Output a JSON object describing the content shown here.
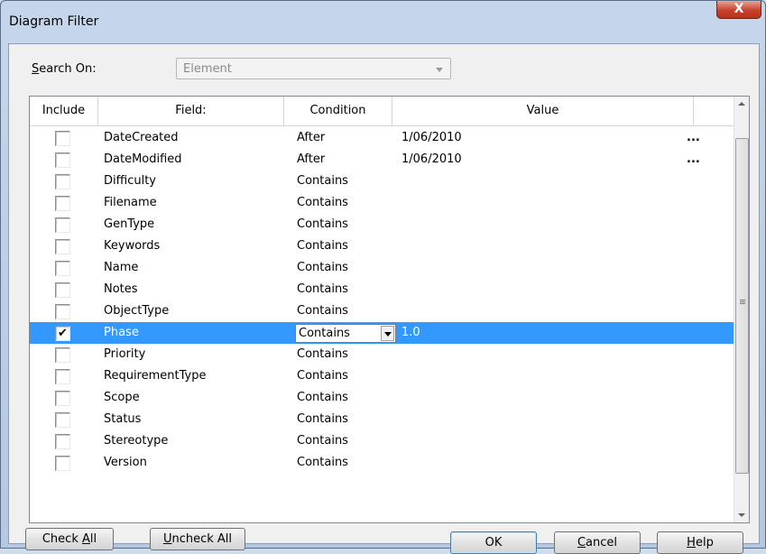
{
  "window": {
    "title": "Diagram Filter",
    "close_label": "X"
  },
  "search": {
    "label_pre": "",
    "label_accel": "S",
    "label_post": "earch On:",
    "value": "Element"
  },
  "grid": {
    "columns": {
      "include": "Include",
      "field": "Field:",
      "condition": "Condition",
      "value": "Value"
    },
    "rows": [
      {
        "field": "DateCreated",
        "condition": "After",
        "value": "1/06/2010",
        "ellipsis": "...",
        "checked": false
      },
      {
        "field": "DateModified",
        "condition": "After",
        "value": "1/06/2010",
        "ellipsis": "...",
        "checked": false
      },
      {
        "field": "Difficulty",
        "condition": "Contains",
        "value": "",
        "checked": false
      },
      {
        "field": "Filename",
        "condition": "Contains",
        "value": "",
        "checked": false
      },
      {
        "field": "GenType",
        "condition": "Contains",
        "value": "",
        "checked": false
      },
      {
        "field": "Keywords",
        "condition": "Contains",
        "value": "",
        "checked": false
      },
      {
        "field": "Name",
        "condition": "Contains",
        "value": "",
        "checked": false
      },
      {
        "field": "Notes",
        "condition": "Contains",
        "value": "",
        "checked": false
      },
      {
        "field": "ObjectType",
        "condition": "Contains",
        "value": "",
        "checked": false
      },
      {
        "field": "Phase",
        "condition": "Contains",
        "value": "1.0",
        "checked": true,
        "selected": true
      },
      {
        "field": "Priority",
        "condition": "Contains",
        "value": "",
        "checked": false
      },
      {
        "field": "RequirementType",
        "condition": "Contains",
        "value": "",
        "checked": false
      },
      {
        "field": "Scope",
        "condition": "Contains",
        "value": "",
        "checked": false
      },
      {
        "field": "Status",
        "condition": "Contains",
        "value": "",
        "checked": false
      },
      {
        "field": "Stereotype",
        "condition": "Contains",
        "value": "",
        "checked": false
      },
      {
        "field": "Version",
        "condition": "Contains",
        "value": "",
        "checked": false
      }
    ]
  },
  "buttons": {
    "check_all": {
      "pre": "Check ",
      "accel": "A",
      "post": "ll"
    },
    "uncheck_all": {
      "pre": "",
      "accel": "U",
      "post": "ncheck All"
    },
    "ok": "OK",
    "cancel": {
      "pre": "",
      "accel": "C",
      "post": "ancel"
    },
    "help": {
      "pre": "",
      "accel": "H",
      "post": "elp"
    }
  },
  "icons": {
    "checkmark": "checkmark-icon",
    "ellipsis": "ellipsis-button",
    "dropdown": "chevron-down-icon"
  },
  "colors": {
    "selection": "#3399ff",
    "window_frame": "#b4c8e2",
    "close_button": "#c7412b"
  }
}
